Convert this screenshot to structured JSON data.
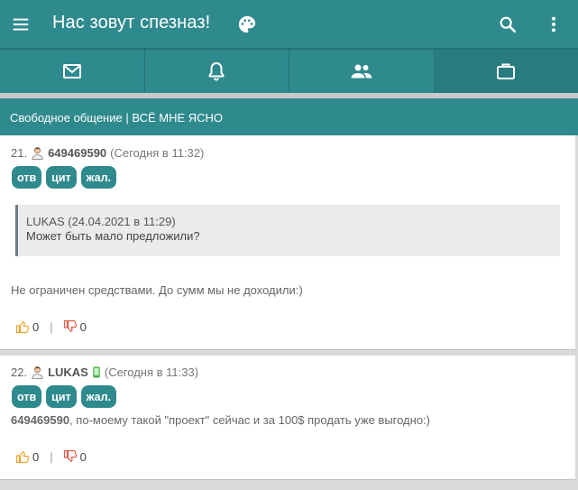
{
  "appbar": {
    "title": "Нас зовут спезназ!",
    "icons": [
      "menu-icon",
      "palette-icon",
      "search-icon",
      "more-vert-icon"
    ]
  },
  "tabs": [
    {
      "icon": "mail-icon"
    },
    {
      "icon": "bell-icon"
    },
    {
      "icon": "people-icon"
    },
    {
      "icon": "briefcase-icon"
    }
  ],
  "section": {
    "title": "Свободное общение | ВСЁ МНЕ ЯСНО"
  },
  "posts": [
    {
      "number": "21.",
      "author": "649469590",
      "time": "(Сегодня в 11:32)",
      "buttons": [
        "отв",
        "цит",
        "жал."
      ],
      "quote": {
        "author": "LUKAS (24.04.2021 в 11:29)",
        "text": "Может быть мало предложили?"
      },
      "text": "Не ограничен средствами. До сумм мы не доходили:)",
      "likes": "0",
      "dislikes": "0"
    },
    {
      "number": "22.",
      "author": "LUKAS",
      "time": "(Сегодня в 11:33)",
      "buttons": [
        "отв",
        "цит",
        "жал."
      ],
      "mention": "649469590",
      "text": ", по-моему такой \"проект\" сейчас и за 100$ продать уже выгодно:)",
      "likes": "0",
      "dislikes": "0"
    }
  ],
  "vote_separator": "|",
  "colors": {
    "accent": "#2f8a8e",
    "like": "#f0a030",
    "dislike": "#e05a4a"
  }
}
